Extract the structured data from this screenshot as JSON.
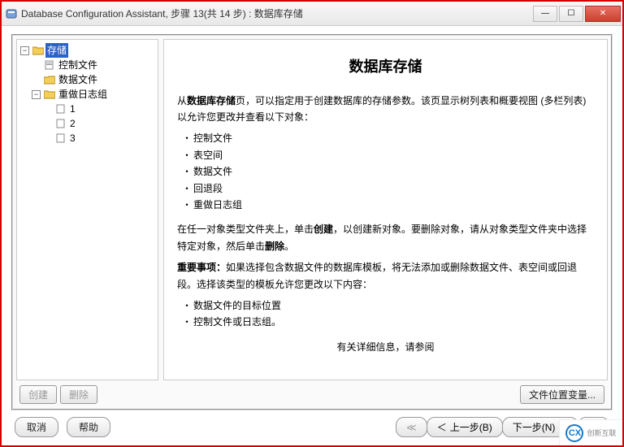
{
  "window": {
    "title": "Database Configuration Assistant, 步骤 13(共 14 步) : 数据库存储",
    "min_label": "—",
    "max_label": "☐",
    "close_label": "✕"
  },
  "tree": {
    "root": {
      "label": "存储",
      "selected": true
    },
    "control_files": "控制文件",
    "data_files": "数据文件",
    "redo_group": "重做日志组",
    "redo_items": [
      "1",
      "2",
      "3"
    ]
  },
  "page": {
    "heading": "数据库存储",
    "intro_p1_a": "从",
    "intro_p1_b": "数据库存储",
    "intro_p1_c": "页，可以指定用于创建数据库的存储参数。该页显示树列表和概要视图 (多栏列表) 以允许您更改并查看以下对象：",
    "bullets1": [
      "控制文件",
      "表空间",
      "数据文件",
      "回退段",
      "重做日志组"
    ],
    "p2_a": "在任一对象类型文件夹上，单击",
    "p2_b": "创建",
    "p2_c": "，以创建新对象。要删除对象，请从对象类型文件夹中选择特定对象，然后单击",
    "p2_d": "删除",
    "p2_e": "。",
    "p3_a": "重要事项：",
    "p3_b": "如果选择包含数据文件的数据库模板，将无法添加或删除数据文件、表空间或回退段。选择该类型的模板允许您更改以下内容：",
    "bullets2": [
      "数据文件的目标位置",
      "控制文件或日志组。"
    ],
    "p4": "有关详细信息，请参阅"
  },
  "actions": {
    "create": "创建",
    "delete": "删除",
    "file_loc": "文件位置变量..."
  },
  "nav": {
    "cancel": "取消",
    "help": "帮助",
    "back": "上一步(B)",
    "next": "下一步(N)",
    "back_glyph_outer": "≪",
    "back_glyph": "＜",
    "next_glyph": "＞",
    "next_glyph_outer": "≫"
  },
  "watermark": {
    "logo": "CX",
    "text": "创新互联"
  }
}
